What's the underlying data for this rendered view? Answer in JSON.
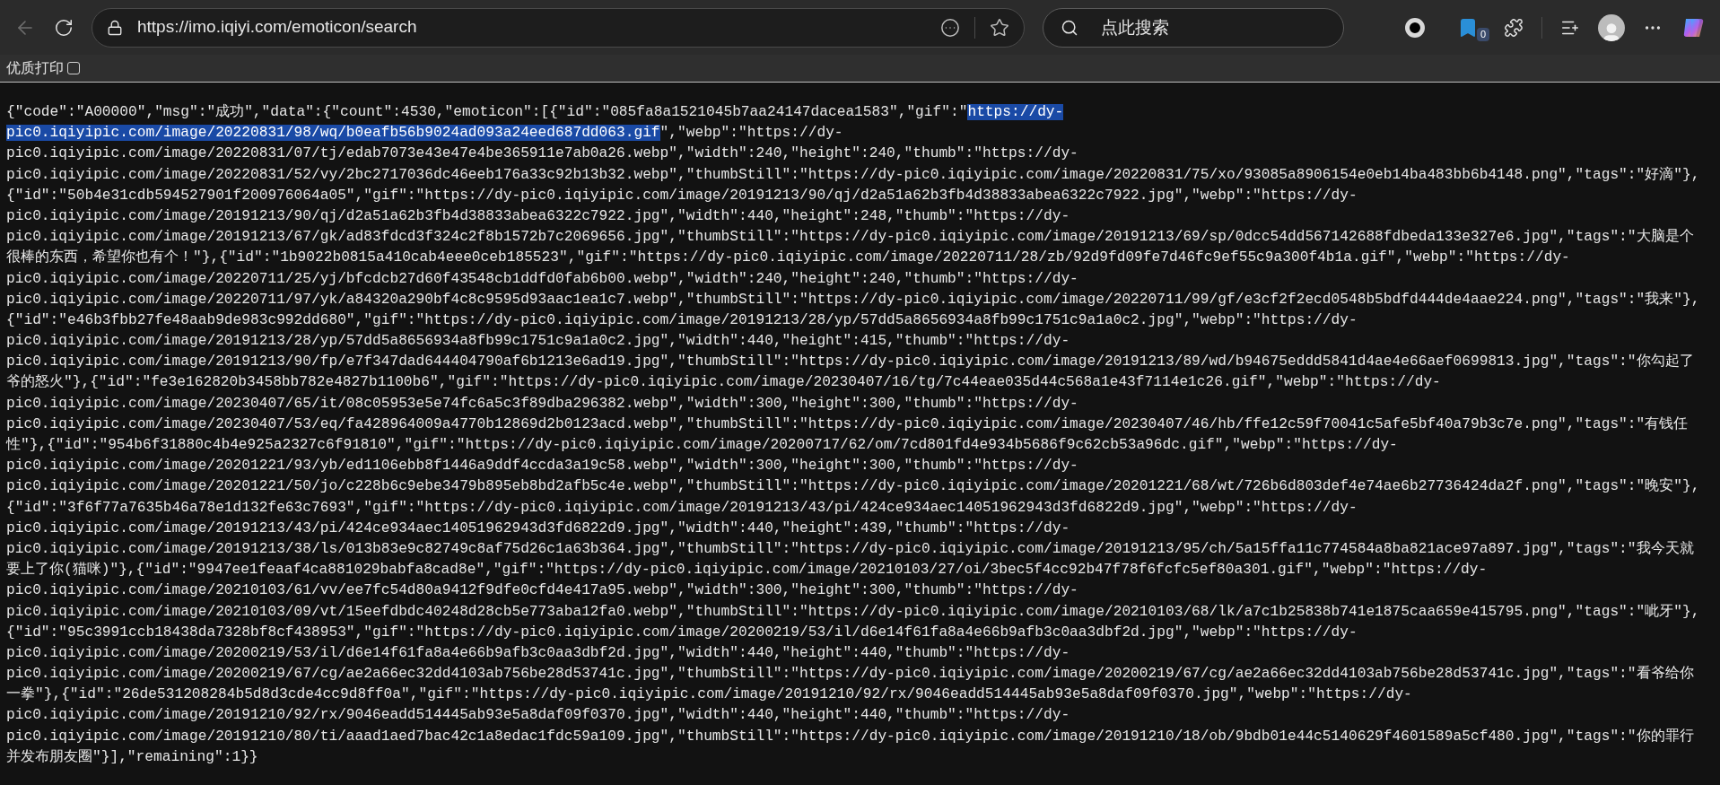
{
  "browser": {
    "back_disabled": true,
    "url": "https://imo.iqiyi.com/emoticon/search",
    "search": {
      "placeholder": "点此搜索"
    },
    "extension_badge": "0"
  },
  "print_option": {
    "label": "优质打印",
    "checked": false
  },
  "document": {
    "lines": [
      {
        "segments": [
          {
            "text": "{\"code\":\"A00000\",\"msg\":\"成功\",\"data\":{\"count\":4530,\"emoticon\":[{\"id\":\"085fa8a1521045b7aa24147dacea1583\",\"gif\":\"",
            "selected": false
          },
          {
            "text": "https://dy-",
            "selected": true
          }
        ]
      },
      {
        "segments": [
          {
            "text": "pic0.iqiyipic.com/image/20220831/98/wq/b0eafb56b9024ad093a24eed687dd063.gif",
            "selected": true
          },
          {
            "text": "\",\"webp\":\"https://dy-",
            "selected": false
          }
        ]
      },
      {
        "text": "pic0.iqiyipic.com/image/20220831/07/tj/edab7073e43e47e4be365911e7ab0a26.webp\",\"width\":240,\"height\":240,\"thumb\":\"https://dy-",
        "selected": false
      },
      {
        "text": "pic0.iqiyipic.com/image/20220831/52/vy/2bc2717036dc46eeb176a33c92b13b32.webp\",\"thumbStill\":\"https://dy-pic0.iqiyipic.com/image/20220831/75/xo/93085a8906154e0eb14ba483bb6b4148.png\",\"tags\":\"好滴\"},",
        "selected": false
      },
      {
        "text": "{\"id\":\"50b4e31cdb594527901f200976064a05\",\"gif\":\"https://dy-pic0.iqiyipic.com/image/20191213/90/qj/d2a51a62b3fb4d38833abea6322c7922.jpg\",\"webp\":\"https://dy-",
        "selected": false
      },
      {
        "text": "pic0.iqiyipic.com/image/20191213/90/qj/d2a51a62b3fb4d38833abea6322c7922.jpg\",\"width\":440,\"height\":248,\"thumb\":\"https://dy-",
        "selected": false
      },
      {
        "text": "pic0.iqiyipic.com/image/20191213/67/gk/ad83fdcd3f324c2f8b1572b7c2069656.jpg\",\"thumbStill\":\"https://dy-pic0.iqiyipic.com/image/20191213/69/sp/0dcc54dd567142688fdbeda133e327e6.jpg\",\"tags\":\"大脑是个",
        "selected": false
      },
      {
        "text": "很棒的东西，希望你也有个！\"},{\"id\":\"1b9022b0815a410cab4eee0ceb185523\",\"gif\":\"https://dy-pic0.iqiyipic.com/image/20220711/28/zb/92d9fd09fe7d46fc9ef55c9a300f4b1a.gif\",\"webp\":\"https://dy-",
        "selected": false
      },
      {
        "text": "pic0.iqiyipic.com/image/20220711/25/yj/bfcdcb27d60f43548cb1ddfd0fab6b00.webp\",\"width\":240,\"height\":240,\"thumb\":\"https://dy-",
        "selected": false
      },
      {
        "text": "pic0.iqiyipic.com/image/20220711/97/yk/a84320a290bf4c8c9595d93aac1ea1c7.webp\",\"thumbStill\":\"https://dy-pic0.iqiyipic.com/image/20220711/99/gf/e3cf2f2ecd0548b5bdfd444de4aae224.png\",\"tags\":\"我来\"},",
        "selected": false
      },
      {
        "text": "{\"id\":\"e46b3fbb27fe48aab9de983c992dd680\",\"gif\":\"https://dy-pic0.iqiyipic.com/image/20191213/28/yp/57dd5a8656934a8fb99c1751c9a1a0c2.jpg\",\"webp\":\"https://dy-",
        "selected": false
      },
      {
        "text": "pic0.iqiyipic.com/image/20191213/28/yp/57dd5a8656934a8fb99c1751c9a1a0c2.jpg\",\"width\":440,\"height\":415,\"thumb\":\"https://dy-",
        "selected": false
      },
      {
        "text": "pic0.iqiyipic.com/image/20191213/90/fp/e7f347dad644404790af6b1213e6ad19.jpg\",\"thumbStill\":\"https://dy-pic0.iqiyipic.com/image/20191213/89/wd/b94675eddd5841d4ae4e66aef0699813.jpg\",\"tags\":\"你勾起了",
        "selected": false
      },
      {
        "text": "爷的怒火\"},{\"id\":\"fe3e162820b3458bb782e4827b1100b6\",\"gif\":\"https://dy-pic0.iqiyipic.com/image/20230407/16/tg/7c44eae035d44c568a1e43f7114e1c26.gif\",\"webp\":\"https://dy-",
        "selected": false
      },
      {
        "text": "pic0.iqiyipic.com/image/20230407/65/it/08c05953e5e74fc6a5c3f89dba296382.webp\",\"width\":300,\"height\":300,\"thumb\":\"https://dy-",
        "selected": false
      },
      {
        "text": "pic0.iqiyipic.com/image/20230407/53/eq/fa428964009a4770b12869d2b0123acd.webp\",\"thumbStill\":\"https://dy-pic0.iqiyipic.com/image/20230407/46/hb/ffe12c59f70041c5afe5bf40a79b3c7e.png\",\"tags\":\"有钱任",
        "selected": false
      },
      {
        "text": "性\"},{\"id\":\"954b6f31880c4b4e925a2327c6f91810\",\"gif\":\"https://dy-pic0.iqiyipic.com/image/20200717/62/om/7cd801fd4e934b5686f9c62cb53a96dc.gif\",\"webp\":\"https://dy-",
        "selected": false
      },
      {
        "text": "pic0.iqiyipic.com/image/20201221/93/yb/ed1106ebb8f1446a9ddf4ccda3a19c58.webp\",\"width\":300,\"height\":300,\"thumb\":\"https://dy-",
        "selected": false
      },
      {
        "text": "pic0.iqiyipic.com/image/20201221/50/jo/c228b6c9ebe3479b895eb8bd2afb5c4e.webp\",\"thumbStill\":\"https://dy-pic0.iqiyipic.com/image/20201221/68/wt/726b6d803def4e74ae6b27736424da2f.png\",\"tags\":\"晚安\"},",
        "selected": false
      },
      {
        "text": "{\"id\":\"3f6f77a7635b46a78e1d132fe63c7693\",\"gif\":\"https://dy-pic0.iqiyipic.com/image/20191213/43/pi/424ce934aec14051962943d3fd6822d9.jpg\",\"webp\":\"https://dy-",
        "selected": false
      },
      {
        "text": "pic0.iqiyipic.com/image/20191213/43/pi/424ce934aec14051962943d3fd6822d9.jpg\",\"width\":440,\"height\":439,\"thumb\":\"https://dy-",
        "selected": false
      },
      {
        "text": "pic0.iqiyipic.com/image/20191213/38/ls/013b83e9c82749c8af75d26c1a63b364.jpg\",\"thumbStill\":\"https://dy-pic0.iqiyipic.com/image/20191213/95/ch/5a15ffa11c774584a8ba821ace97a897.jpg\",\"tags\":\"我今天就",
        "selected": false
      },
      {
        "text": "要上了你(猫咪)\"},{\"id\":\"9947ee1feaaf4ca881029babfa8cad8e\",\"gif\":\"https://dy-pic0.iqiyipic.com/image/20210103/27/oi/3bec5f4cc92b47f78f6fcfc5ef80a301.gif\",\"webp\":\"https://dy-",
        "selected": false
      },
      {
        "text": "pic0.iqiyipic.com/image/20210103/61/vv/ee7fc54d80a9412f9dfe0cfd4e417a95.webp\",\"width\":300,\"height\":300,\"thumb\":\"https://dy-",
        "selected": false
      },
      {
        "text": "pic0.iqiyipic.com/image/20210103/09/vt/15eefdbdc40248d28cb5e773aba12fa0.webp\",\"thumbStill\":\"https://dy-pic0.iqiyipic.com/image/20210103/68/lk/a7c1b25838b741e1875caa659e415795.png\",\"tags\":\"呲牙\"},",
        "selected": false
      },
      {
        "text": "{\"id\":\"95c3991ccb18438da7328bf8cf438953\",\"gif\":\"https://dy-pic0.iqiyipic.com/image/20200219/53/il/d6e14f61fa8a4e66b9afb3c0aa3dbf2d.jpg\",\"webp\":\"https://dy-",
        "selected": false
      },
      {
        "text": "pic0.iqiyipic.com/image/20200219/53/il/d6e14f61fa8a4e66b9afb3c0aa3dbf2d.jpg\",\"width\":440,\"height\":440,\"thumb\":\"https://dy-",
        "selected": false
      },
      {
        "text": "pic0.iqiyipic.com/image/20200219/67/cg/ae2a66ec32dd4103ab756be28d53741c.jpg\",\"thumbStill\":\"https://dy-pic0.iqiyipic.com/image/20200219/67/cg/ae2a66ec32dd4103ab756be28d53741c.jpg\",\"tags\":\"看爷给你",
        "selected": false
      },
      {
        "text": "一拳\"},{\"id\":\"26de531208284b5d8d3cde4cc9d8ff0a\",\"gif\":\"https://dy-pic0.iqiyipic.com/image/20191210/92/rx/9046eadd514445ab93e5a8daf09f0370.jpg\",\"webp\":\"https://dy-",
        "selected": false
      },
      {
        "text": "pic0.iqiyipic.com/image/20191210/92/rx/9046eadd514445ab93e5a8daf09f0370.jpg\",\"width\":440,\"height\":440,\"thumb\":\"https://dy-",
        "selected": false
      },
      {
        "text": "pic0.iqiyipic.com/image/20191210/80/ti/aaad1aed7bac42c1a8edac1fdc59a109.jpg\",\"thumbStill\":\"https://dy-pic0.iqiyipic.com/image/20191210/18/ob/9bdb01e44c5140629f4601589a5cf480.jpg\",\"tags\":\"你的罪行",
        "selected": false
      },
      {
        "text": "并发布朋友圈\"}],\"remaining\":1}}",
        "selected": false
      }
    ]
  }
}
